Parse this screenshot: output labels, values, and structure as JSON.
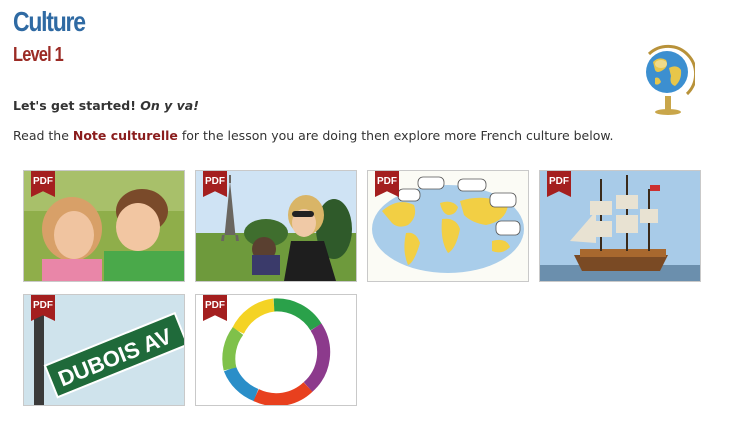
{
  "header": {
    "title": "Culture",
    "level": "Level 1"
  },
  "intro": {
    "lead": "Let's get started!",
    "lead_italic": "On y va!"
  },
  "description": {
    "before": "Read the ",
    "highlight": "Note culturelle",
    "after": " for the lesson you are doing then explore more French culture below."
  },
  "colors": {
    "title": "#2f6aa3",
    "level": "#9b2b25",
    "highlight": "#8a1c1c",
    "badge": "#a41f1f"
  },
  "tiles": [
    {
      "badge": "PDF",
      "image": "children-photo"
    },
    {
      "badge": "PDF",
      "image": "eiffel-tower-photo"
    },
    {
      "badge": "PDF",
      "image": "world-map-cartoon"
    },
    {
      "badge": "PDF",
      "image": "sailing-ship-photo"
    },
    {
      "badge": "PDF",
      "street_sign": "DUBOIS AV",
      "image": "street-sign-photo"
    },
    {
      "badge": "PDF",
      "image": "color-ring-graphic"
    }
  ]
}
